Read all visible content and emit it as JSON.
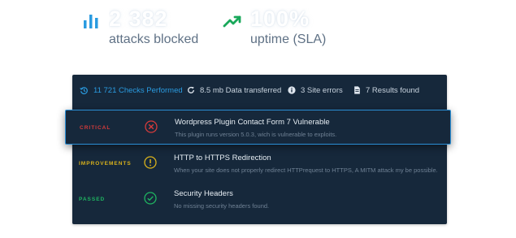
{
  "stats": [
    {
      "icon": "bar-chart-icon",
      "value": "2 382",
      "label": "attacks blocked",
      "color": "#2a9be0"
    },
    {
      "icon": "trend-up-icon",
      "value": "100%",
      "label": "uptime (SLA)",
      "color": "#19a85a"
    }
  ],
  "topbar": {
    "checks": "11 721 Checks Performed",
    "data": "8.5 mb Data transferred",
    "errors": "3 Site errors",
    "results": "7 Results found"
  },
  "results": [
    {
      "status": "CRITICAL",
      "status_color": "#d63b3b",
      "icon": "x-circle-icon",
      "title": "Wordpress Plugin Contact Form 7 Vulnerable",
      "description": "This plugin runs version 5.0.3, wich is vulnerable to exploits."
    },
    {
      "status": "IMPROVEMENTS",
      "status_color": "#d9b21c",
      "icon": "warning-circle-icon",
      "title": "HTTP to HTTPS Redirection",
      "description": "When your site does not properly redirect HTTPrequest to HTTPS, A MITM attack my be possible."
    },
    {
      "status": "PASSED",
      "status_color": "#1fb461",
      "icon": "check-circle-icon",
      "title": "Security Headers",
      "description": "No missing security headers found."
    }
  ]
}
